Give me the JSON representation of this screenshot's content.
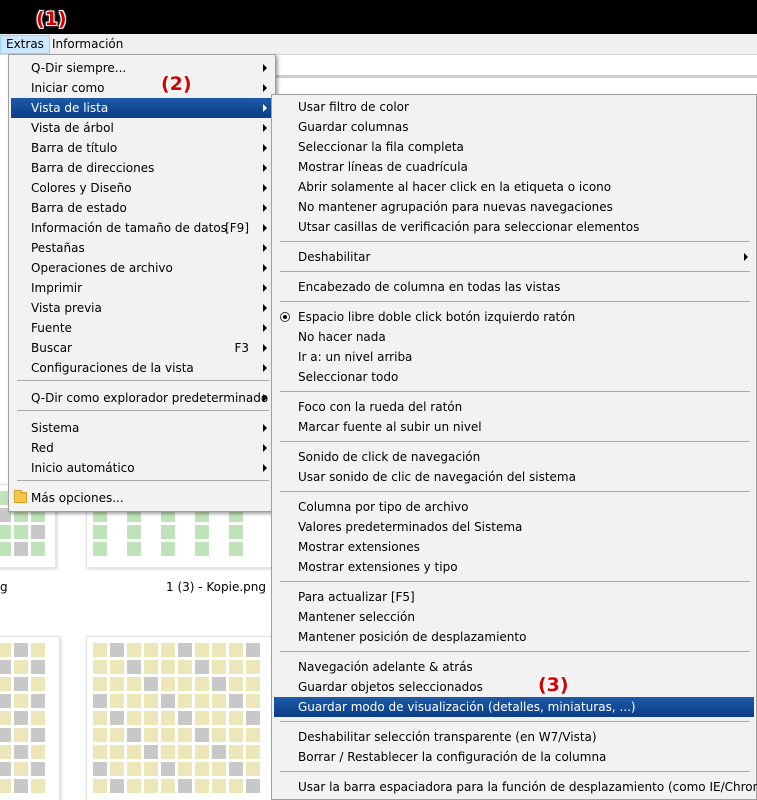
{
  "menubar": {
    "extras": "Extras",
    "informacion": "Información"
  },
  "badges": {
    "b1": "(1)",
    "b2": "(2)",
    "b3": "(3)"
  },
  "files": {
    "left": "g",
    "right": "1 (3) - Kopie.png"
  },
  "main_menu": {
    "items": [
      {
        "label": "Q-Dir siempre...",
        "arrow": true
      },
      {
        "label": "Iniciar como",
        "arrow": true
      },
      {
        "label": "Vista de lista",
        "arrow": true,
        "highlighted": true
      },
      {
        "label": "Vista de árbol",
        "arrow": true
      },
      {
        "label": "Barra de título",
        "arrow": true
      },
      {
        "label": "Barra de direcciones",
        "arrow": true
      },
      {
        "label": "Colores y Diseño",
        "arrow": true
      },
      {
        "label": "Barra de estado",
        "arrow": true
      },
      {
        "label": "Información de tamaño de datos",
        "shortcut": "[F9]",
        "arrow": true
      },
      {
        "label": "Pestañas",
        "arrow": true
      },
      {
        "label": "Operaciones de archivo",
        "arrow": true
      },
      {
        "label": "Imprimir",
        "arrow": true
      },
      {
        "label": "Vista previa",
        "arrow": true
      },
      {
        "label": "Fuente",
        "arrow": true
      },
      {
        "label": "Buscar",
        "shortcut": "F3",
        "arrow": true
      },
      {
        "label": "Configuraciones de la vista",
        "arrow": true
      },
      {
        "label": "Q-Dir como explorador predeterminado",
        "arrow": true
      },
      {
        "label": "Sistema",
        "arrow": true
      },
      {
        "label": "Red",
        "arrow": true
      },
      {
        "label": "Inicio automático",
        "arrow": true
      },
      {
        "label": "Más opciones...",
        "icon": "folder-icon"
      }
    ]
  },
  "sub_menu": {
    "items": [
      {
        "label": "Usar filtro de color"
      },
      {
        "label": "Guardar columnas"
      },
      {
        "label": "Seleccionar la fila completa"
      },
      {
        "label": "Mostrar líneas de cuadrícula"
      },
      {
        "label": "Abrir solamente al hacer click en la etiqueta o icono"
      },
      {
        "label": "No mantener agrupación para nuevas navegaciones"
      },
      {
        "label": "Utsar casillas de verificación para seleccionar elementos"
      },
      {
        "label": "Deshabilitar",
        "arrow": true
      },
      {
        "label": "Encabezado de columna en todas las vistas"
      },
      {
        "label": "Espacio libre doble click botón izquierdo ratón",
        "icon": "radio-selected-icon"
      },
      {
        "label": "No hacer nada"
      },
      {
        "label": "Ir a: un nivel arriba"
      },
      {
        "label": "Seleccionar todo"
      },
      {
        "label": "Foco con la rueda del ratón"
      },
      {
        "label": "Marcar fuente al subir un nivel"
      },
      {
        "label": "Sonido de click de navegación"
      },
      {
        "label": "Usar sonido de clic de navegación del sistema"
      },
      {
        "label": "Columna por tipo de archivo"
      },
      {
        "label": "Valores predeterminados del Sistema"
      },
      {
        "label": "Mostrar extensiones"
      },
      {
        "label": "Mostrar extensiones y tipo"
      },
      {
        "label": "Para actualizar [F5]"
      },
      {
        "label": "Mantener selección"
      },
      {
        "label": "Mantener posición de desplazamiento"
      },
      {
        "label": "Navegación adelante & atrás"
      },
      {
        "label": "Guardar objetos seleccionados"
      },
      {
        "label": "Guardar modo de visualización (detalles, miniaturas, ...)",
        "highlighted": true
      },
      {
        "label": "Deshabilitar selección transparente (en W7/Vista)"
      },
      {
        "label": "Borrar / Restablecer la configuración de la columna"
      },
      {
        "label": "Usar la barra espaciadora para la función de desplazamiento (como IE/Chrome)"
      }
    ]
  }
}
